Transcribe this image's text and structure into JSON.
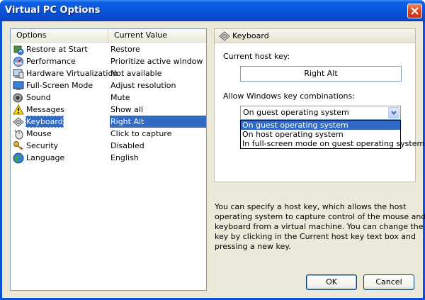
{
  "window": {
    "title": "Virtual PC Options"
  },
  "list": {
    "columns": [
      "Options",
      "Current Value"
    ],
    "rows": [
      {
        "name": "Restore at Start",
        "value": "Restore",
        "icon": "restore-icon"
      },
      {
        "name": "Performance",
        "value": "Prioritize active window",
        "icon": "performance-icon"
      },
      {
        "name": "Hardware Virtualization",
        "value": "Not available",
        "icon": "hardware-icon"
      },
      {
        "name": "Full-Screen Mode",
        "value": "Adjust resolution",
        "icon": "fullscreen-icon"
      },
      {
        "name": "Sound",
        "value": "Mute",
        "icon": "sound-icon"
      },
      {
        "name": "Messages",
        "value": "Show all",
        "icon": "warning-icon"
      },
      {
        "name": "Keyboard",
        "value": "Right Alt",
        "icon": "keyboard-icon",
        "selected": true
      },
      {
        "name": "Mouse",
        "value": "Click to capture",
        "icon": "mouse-icon"
      },
      {
        "name": "Security",
        "value": "Disabled",
        "icon": "keys-icon"
      },
      {
        "name": "Language",
        "value": "English",
        "icon": "globe-icon"
      }
    ]
  },
  "panel": {
    "title": "Keyboard",
    "host_key_label": "Current host key:",
    "host_key_value": "Right Alt",
    "combo_label": "Allow Windows key combinations:",
    "combo_value": "On guest operating system",
    "options": [
      "On guest operating system",
      "On host operating system",
      "In full-screen mode on guest operating system"
    ],
    "selected_option_index": 0
  },
  "description": [
    "You can specify a host key, which allows the host",
    "operating system to capture control of the mouse and",
    "keyboard from a virtual machine. You can change the host",
    "key by clicking in the Current host key text box and",
    "pressing a new key."
  ],
  "buttons": {
    "ok": "OK",
    "cancel": "Cancel"
  },
  "colors": {
    "selection": "#316ac5",
    "titlebar": "#0a55d9",
    "dialog_bg": "#ece9d8"
  }
}
